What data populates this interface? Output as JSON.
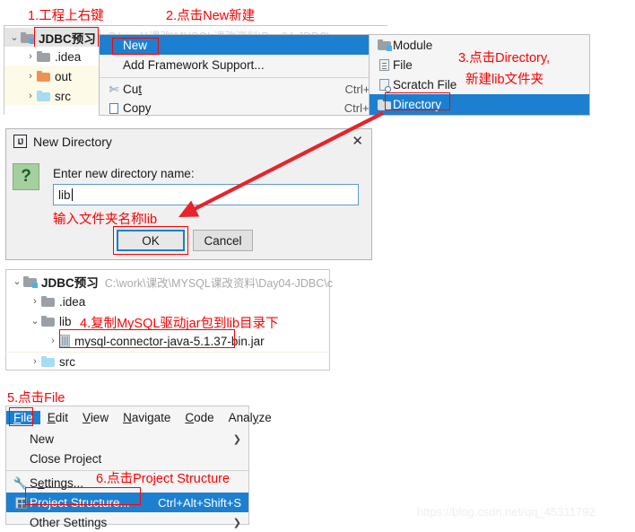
{
  "annotations": {
    "step1": "1.工程上右键",
    "step2": "2.点击New新建",
    "step3_line1": "3.点击Directory,",
    "step3_line2": "新建lib文件夹",
    "step_input": "输入文件夹名称lib",
    "step4": "4.复制MySQL驱动jar包到lib目录下",
    "step5": "5.点击File",
    "step6": "6.点击Project Structure"
  },
  "colors": {
    "accent_blue": "#1d7fd0",
    "annotation_red": "#ff0000",
    "folder_gray": "#9aa0a6",
    "folder_orange": "#ef9055",
    "folder_blue": "#a6dcf0"
  },
  "project_tree_top": {
    "root": {
      "label": "JDBC预习",
      "twisty": "⌄"
    },
    "children": [
      {
        "label": ".idea",
        "twisty": "›",
        "folder": "gray"
      },
      {
        "label": "out",
        "twisty": "›",
        "folder": "orange"
      },
      {
        "label": "src",
        "twisty": "›",
        "folder": "blue"
      }
    ],
    "background_path": "C:\\work\\课改\\MYSQL课改资料\\Day04-JDBC\\"
  },
  "context_menu": {
    "items": [
      {
        "label": "New",
        "accel": "",
        "arrow": "❯",
        "selected": true
      },
      {
        "label": "Add Framework Support...",
        "accel": "",
        "arrow": "",
        "selected": false
      },
      {
        "label": "Cut",
        "label_pre": "Cu",
        "label_mnemonic": "t",
        "accel": "Ctrl+X",
        "arrow": "",
        "selected": false,
        "icon": "scissors-icon"
      },
      {
        "label": "Copy",
        "accel": "Ctrl+C",
        "arrow": "",
        "selected": false,
        "icon": "copy-icon"
      }
    ]
  },
  "new_submenu": {
    "items": [
      {
        "label": "Module",
        "icon": "module-folder-icon",
        "selected": false
      },
      {
        "label": "File",
        "icon": "file-icon",
        "selected": false
      },
      {
        "label": "Scratch File",
        "icon": "scratch-file-icon",
        "selected": false
      },
      {
        "label": "Directory",
        "icon": "directory-folder-icon",
        "selected": true
      }
    ]
  },
  "new_directory_dialog": {
    "title": "New Directory",
    "icon_text": "IJ",
    "close_glyph": "✕",
    "question_glyph": "?",
    "prompt": "Enter new directory name:",
    "input_value": "lib",
    "input_placeholder": "",
    "ok_label": "OK",
    "cancel_label": "Cancel"
  },
  "project_tree_bottom": {
    "root": {
      "label": "JDBC预习",
      "twisty": "⌄",
      "path": "C:\\work\\课改\\MYSQL课改资料\\Day04-JDBC\\c"
    },
    "children": [
      {
        "label": ".idea",
        "twisty": "›",
        "folder": "gray",
        "indent": 0
      },
      {
        "label": "lib",
        "twisty": "⌄",
        "folder": "gray",
        "indent": 0
      },
      {
        "label": "mysql-connector-java-5.1.37-bin.jar",
        "twisty": "›",
        "folder": "jar",
        "indent": 1
      },
      {
        "label": "src",
        "twisty": "›",
        "folder": "blue",
        "indent": 0
      }
    ]
  },
  "file_menu": {
    "menubar": [
      {
        "pre": "",
        "mnemonic": "F",
        "post": "ile",
        "active": true
      },
      {
        "pre": "",
        "mnemonic": "E",
        "post": "dit",
        "active": false
      },
      {
        "pre": "",
        "mnemonic": "V",
        "post": "iew",
        "active": false
      },
      {
        "pre": "",
        "mnemonic": "N",
        "post": "avigate",
        "active": false
      },
      {
        "pre": "",
        "mnemonic": "C",
        "post": "ode",
        "active": false
      },
      {
        "pre": "Anal",
        "mnemonic": "y",
        "post": "ze",
        "active": false
      }
    ],
    "items": [
      {
        "label": "New",
        "accel": "",
        "arrow": "❯",
        "selected": false,
        "icon": ""
      },
      {
        "label": "Close Project",
        "accel": "",
        "arrow": "",
        "selected": false,
        "icon": ""
      },
      {
        "label": "Settings...",
        "accel": "",
        "arrow": "",
        "selected": false,
        "icon": "wrench-icon"
      },
      {
        "label": "Project Structure...",
        "accel": "Ctrl+Alt+Shift+S",
        "arrow": "",
        "selected": true,
        "icon": "project-structure-icon"
      },
      {
        "label": "Other Settings",
        "accel": "",
        "arrow": "❯",
        "selected": false,
        "icon": ""
      }
    ]
  },
  "watermark": {
    "text": "https://blog.csdn.net/qq_45311792"
  }
}
